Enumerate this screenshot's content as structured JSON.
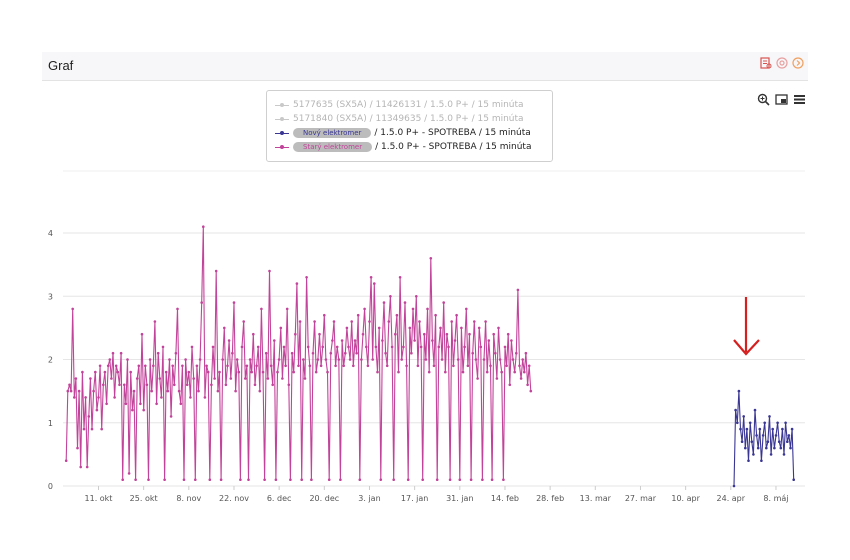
{
  "panel": {
    "title": "Graf"
  },
  "header_icons": [
    "report-icon",
    "settings-icon",
    "next-icon"
  ],
  "toolbar": [
    "zoom-icon",
    "expand-icon",
    "menu-icon"
  ],
  "colors": {
    "old_meter": "#c2439a",
    "new_meter": "#3a3694",
    "arrow": "#d61f1f",
    "grid": "#e6e6e6"
  },
  "legend": [
    {
      "id": "s1",
      "text": "5177635 (SX5A) / 11426131 / 1.5.0 P+ / 15 minúta",
      "hidden": true
    },
    {
      "id": "s2",
      "text": "5171840 (SX5A) / 11349635 / 1.5.0 P+ / 15 minúta",
      "hidden": true
    },
    {
      "id": "s3",
      "name": "Nový elektromer",
      "text": "/ 1.5.0 P+ - SPOTREBA / 15 minúta",
      "hidden": false
    },
    {
      "id": "s4",
      "name": "Starý elektromer",
      "text": "/ 1.5.0 P+ - SPOTREBA / 15 minúta",
      "hidden": false
    }
  ],
  "chart_data": {
    "type": "line",
    "x_unit": "day",
    "xlim": [
      "2023-09-30",
      "2024-05-17"
    ],
    "ylim": [
      0,
      4.5
    ],
    "yticks": [
      0,
      1,
      2,
      3,
      4
    ],
    "xticks": [
      {
        "date": "2023-10-11",
        "label": "11. okt"
      },
      {
        "date": "2023-10-25",
        "label": "25. okt"
      },
      {
        "date": "2023-11-08",
        "label": "8. nov"
      },
      {
        "date": "2023-11-22",
        "label": "22. nov"
      },
      {
        "date": "2023-12-06",
        "label": "6. dec"
      },
      {
        "date": "2023-12-20",
        "label": "20. dec"
      },
      {
        "date": "2024-01-03",
        "label": "3. jan"
      },
      {
        "date": "2024-01-17",
        "label": "17. jan"
      },
      {
        "date": "2024-01-31",
        "label": "31. jan"
      },
      {
        "date": "2024-02-14",
        "label": "14. feb"
      },
      {
        "date": "2024-02-28",
        "label": "28. feb"
      },
      {
        "date": "2024-03-13",
        "label": "13. mar"
      },
      {
        "date": "2024-03-27",
        "label": "27. mar"
      },
      {
        "date": "2024-04-10",
        "label": "10. apr"
      },
      {
        "date": "2024-04-24",
        "label": "24. apr"
      },
      {
        "date": "2024-05-08",
        "label": "8. máj"
      }
    ],
    "grid": true,
    "legend_position": "top-center",
    "series": [
      {
        "name": "Starý elektromer",
        "color": "#c2439a",
        "start": "2023-10-01",
        "step_days": 0.5,
        "values": [
          0.4,
          1.5,
          1.6,
          1.5,
          2.8,
          1.4,
          1.7,
          0.6,
          1.5,
          0.3,
          1.8,
          0.9,
          1.4,
          0.3,
          1.1,
          1.7,
          0.9,
          1.5,
          1.8,
          1.2,
          1.4,
          1.9,
          0.9,
          1.6,
          1.8,
          1.3,
          1.9,
          2.0,
          1.7,
          2.1,
          1.4,
          1.9,
          1.8,
          1.6,
          2.1,
          0.1,
          1.6,
          1.3,
          2.0,
          0.2,
          1.8,
          1.2,
          1.5,
          0.1,
          1.7,
          1.9,
          1.3,
          2.4,
          1.2,
          1.9,
          1.6,
          0.1,
          2.0,
          1.5,
          1.9,
          2.6,
          1.3,
          2.1,
          1.7,
          1.4,
          2.2,
          0.1,
          1.8,
          1.5,
          2.0,
          1.1,
          1.9,
          1.6,
          2.1,
          2.8,
          1.5,
          1.3,
          1.9,
          0.1,
          2.0,
          1.6,
          1.8,
          1.4,
          2.2,
          1.7,
          0.1,
          1.9,
          1.5,
          2.0,
          2.9,
          4.1,
          1.4,
          1.9,
          1.8,
          0.1,
          1.6,
          2.2,
          1.7,
          3.4,
          1.5,
          1.8,
          0.1,
          2.0,
          2.5,
          1.6,
          1.9,
          2.3,
          1.7,
          2.1,
          2.9,
          1.5,
          2.0,
          1.8,
          0.1,
          2.2,
          2.6,
          1.7,
          1.9,
          0.1,
          2.0,
          1.8,
          2.4,
          1.6,
          1.9,
          2.2,
          1.5,
          2.8,
          1.8,
          0.1,
          2.1,
          1.7,
          3.4,
          1.9,
          1.6,
          2.3,
          0.1,
          1.8,
          2.0,
          2.5,
          1.7,
          2.2,
          1.9,
          2.8,
          1.6,
          0.1,
          2.1,
          1.8,
          2.4,
          3.2,
          1.9,
          2.6,
          0.1,
          2.0,
          1.7,
          3.3,
          2.2,
          1.9,
          0.1,
          2.1,
          2.6,
          1.8,
          2.0,
          2.4,
          1.9,
          2.2,
          2.7,
          2.0,
          1.8,
          0.1,
          2.1,
          2.3,
          2.6,
          1.9,
          2.2,
          2.0,
          0.1,
          2.3,
          1.9,
          2.1,
          2.5,
          2.2,
          2.0,
          2.6,
          1.9,
          2.3,
          2.1,
          2.7,
          0.1,
          2.0,
          2.4,
          2.8,
          2.2,
          1.9,
          2.6,
          3.3,
          2.0,
          3.2,
          2.2,
          1.8,
          2.5,
          0.1,
          2.3,
          2.9,
          2.1,
          1.9,
          2.6,
          3.0,
          2.2,
          0.1,
          2.4,
          2.7,
          1.8,
          3.3,
          2.0,
          2.2,
          2.9,
          1.9,
          0.1,
          2.5,
          2.1,
          2.8,
          2.3,
          3.0,
          1.9,
          2.6,
          2.2,
          0.1,
          2.4,
          2.0,
          2.8,
          1.8,
          3.6,
          2.3,
          1.9,
          2.7,
          0.1,
          2.2,
          2.5,
          2.0,
          2.9,
          1.8,
          2.4,
          2.2,
          0.1,
          2.6,
          1.9,
          2.3,
          2.7,
          2.0,
          0.1,
          2.5,
          1.8,
          2.2,
          2.8,
          1.9,
          2.4,
          0.1,
          2.1,
          2.6,
          2.0,
          1.7,
          2.5,
          2.2,
          0.1,
          2.0,
          2.6,
          1.8,
          2.3,
          1.9,
          0.1,
          2.4,
          2.1,
          1.7,
          2.5,
          2.0,
          1.8,
          0.1,
          2.2,
          1.9,
          2.4,
          1.6,
          2.3,
          2.0,
          1.8,
          2.1,
          3.1,
          1.9,
          1.7,
          2.0,
          1.8,
          2.1,
          1.6,
          1.9,
          1.5
        ]
      },
      {
        "name": "Nový elektromer",
        "color": "#3a3694",
        "start": "2024-04-25",
        "step_days": 0.5,
        "values": [
          0.0,
          1.2,
          1.0,
          1.5,
          0.9,
          0.7,
          1.1,
          0.6,
          0.9,
          0.4,
          1.0,
          0.7,
          0.5,
          1.2,
          0.8,
          0.6,
          0.9,
          0.4,
          0.8,
          1.0,
          0.6,
          0.7,
          1.1,
          0.5,
          0.9,
          0.6,
          0.8,
          1.0,
          0.7,
          0.6,
          0.9,
          0.5,
          1.0,
          0.7,
          0.8,
          0.6,
          0.9,
          0.1
        ]
      }
    ]
  }
}
